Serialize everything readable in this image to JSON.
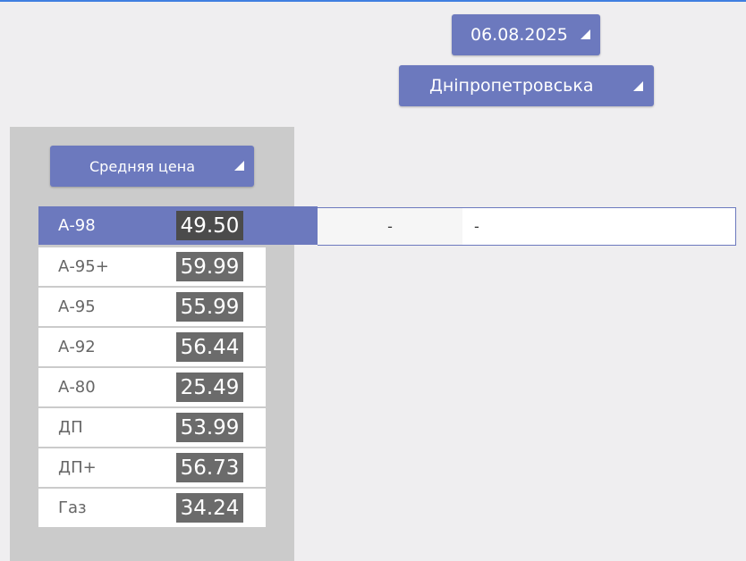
{
  "filters": {
    "date": "06.08.2025",
    "region": "Дніпропетровська",
    "metric": "Средняя цена"
  },
  "fuels": [
    {
      "name": "А-98",
      "price": "49.50",
      "selected": true
    },
    {
      "name": "А-95+",
      "price": "59.99"
    },
    {
      "name": "А-95",
      "price": "55.99"
    },
    {
      "name": "А-92",
      "price": "56.44"
    },
    {
      "name": "А-80",
      "price": "25.49"
    },
    {
      "name": "ДП",
      "price": "53.99"
    },
    {
      "name": "ДП+",
      "price": "56.73"
    },
    {
      "name": "Газ",
      "price": "34.24"
    }
  ],
  "detail": {
    "col1": "-",
    "col2": "-"
  },
  "colors": {
    "accent": "#6c79be",
    "price_box": "#6b6b6b",
    "price_box_selected": "#4b4b4b",
    "panel": "#cbcbcb",
    "background": "#efeef0",
    "top_line": "#3f7fe0"
  }
}
